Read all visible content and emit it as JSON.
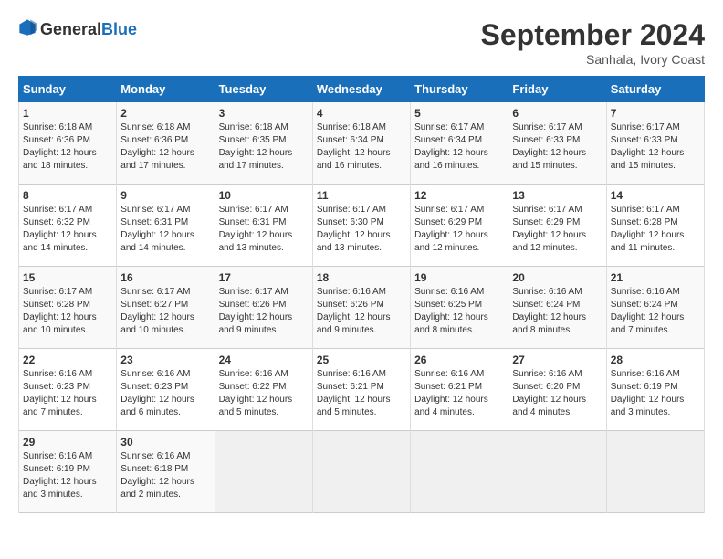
{
  "header": {
    "logo": {
      "general": "General",
      "blue": "Blue"
    },
    "title": "September 2024",
    "location": "Sanhala, Ivory Coast"
  },
  "days_of_week": [
    "Sunday",
    "Monday",
    "Tuesday",
    "Wednesday",
    "Thursday",
    "Friday",
    "Saturday"
  ],
  "weeks": [
    [
      {
        "day": "1",
        "sunrise": "6:18 AM",
        "sunset": "6:36 PM",
        "daylight": "12 hours and 18 minutes."
      },
      {
        "day": "2",
        "sunrise": "6:18 AM",
        "sunset": "6:36 PM",
        "daylight": "12 hours and 17 minutes."
      },
      {
        "day": "3",
        "sunrise": "6:18 AM",
        "sunset": "6:35 PM",
        "daylight": "12 hours and 17 minutes."
      },
      {
        "day": "4",
        "sunrise": "6:18 AM",
        "sunset": "6:34 PM",
        "daylight": "12 hours and 16 minutes."
      },
      {
        "day": "5",
        "sunrise": "6:17 AM",
        "sunset": "6:34 PM",
        "daylight": "12 hours and 16 minutes."
      },
      {
        "day": "6",
        "sunrise": "6:17 AM",
        "sunset": "6:33 PM",
        "daylight": "12 hours and 15 minutes."
      },
      {
        "day": "7",
        "sunrise": "6:17 AM",
        "sunset": "6:33 PM",
        "daylight": "12 hours and 15 minutes."
      }
    ],
    [
      {
        "day": "8",
        "sunrise": "6:17 AM",
        "sunset": "6:32 PM",
        "daylight": "12 hours and 14 minutes."
      },
      {
        "day": "9",
        "sunrise": "6:17 AM",
        "sunset": "6:31 PM",
        "daylight": "12 hours and 14 minutes."
      },
      {
        "day": "10",
        "sunrise": "6:17 AM",
        "sunset": "6:31 PM",
        "daylight": "12 hours and 13 minutes."
      },
      {
        "day": "11",
        "sunrise": "6:17 AM",
        "sunset": "6:30 PM",
        "daylight": "12 hours and 13 minutes."
      },
      {
        "day": "12",
        "sunrise": "6:17 AM",
        "sunset": "6:29 PM",
        "daylight": "12 hours and 12 minutes."
      },
      {
        "day": "13",
        "sunrise": "6:17 AM",
        "sunset": "6:29 PM",
        "daylight": "12 hours and 12 minutes."
      },
      {
        "day": "14",
        "sunrise": "6:17 AM",
        "sunset": "6:28 PM",
        "daylight": "12 hours and 11 minutes."
      }
    ],
    [
      {
        "day": "15",
        "sunrise": "6:17 AM",
        "sunset": "6:28 PM",
        "daylight": "12 hours and 10 minutes."
      },
      {
        "day": "16",
        "sunrise": "6:17 AM",
        "sunset": "6:27 PM",
        "daylight": "12 hours and 10 minutes."
      },
      {
        "day": "17",
        "sunrise": "6:17 AM",
        "sunset": "6:26 PM",
        "daylight": "12 hours and 9 minutes."
      },
      {
        "day": "18",
        "sunrise": "6:16 AM",
        "sunset": "6:26 PM",
        "daylight": "12 hours and 9 minutes."
      },
      {
        "day": "19",
        "sunrise": "6:16 AM",
        "sunset": "6:25 PM",
        "daylight": "12 hours and 8 minutes."
      },
      {
        "day": "20",
        "sunrise": "6:16 AM",
        "sunset": "6:24 PM",
        "daylight": "12 hours and 8 minutes."
      },
      {
        "day": "21",
        "sunrise": "6:16 AM",
        "sunset": "6:24 PM",
        "daylight": "12 hours and 7 minutes."
      }
    ],
    [
      {
        "day": "22",
        "sunrise": "6:16 AM",
        "sunset": "6:23 PM",
        "daylight": "12 hours and 7 minutes."
      },
      {
        "day": "23",
        "sunrise": "6:16 AM",
        "sunset": "6:23 PM",
        "daylight": "12 hours and 6 minutes."
      },
      {
        "day": "24",
        "sunrise": "6:16 AM",
        "sunset": "6:22 PM",
        "daylight": "12 hours and 5 minutes."
      },
      {
        "day": "25",
        "sunrise": "6:16 AM",
        "sunset": "6:21 PM",
        "daylight": "12 hours and 5 minutes."
      },
      {
        "day": "26",
        "sunrise": "6:16 AM",
        "sunset": "6:21 PM",
        "daylight": "12 hours and 4 minutes."
      },
      {
        "day": "27",
        "sunrise": "6:16 AM",
        "sunset": "6:20 PM",
        "daylight": "12 hours and 4 minutes."
      },
      {
        "day": "28",
        "sunrise": "6:16 AM",
        "sunset": "6:19 PM",
        "daylight": "12 hours and 3 minutes."
      }
    ],
    [
      {
        "day": "29",
        "sunrise": "6:16 AM",
        "sunset": "6:19 PM",
        "daylight": "12 hours and 3 minutes."
      },
      {
        "day": "30",
        "sunrise": "6:16 AM",
        "sunset": "6:18 PM",
        "daylight": "12 hours and 2 minutes."
      },
      null,
      null,
      null,
      null,
      null
    ]
  ]
}
